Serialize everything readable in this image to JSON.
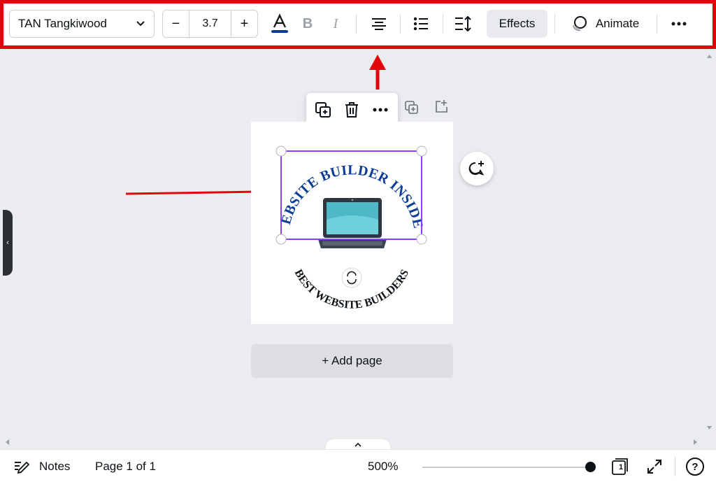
{
  "toolbar": {
    "font_name": "TAN Tangkiwood",
    "font_size": "3.7",
    "minus_label": "−",
    "plus_label": "+",
    "effects_label": "Effects",
    "animate_label": "Animate",
    "text_color": "#0b3c96",
    "highlight_color": "#e0060c"
  },
  "canvas": {
    "logo_top_text": "WEBSITE BUILDER INSIDER",
    "logo_bottom_text": "BEST WEBSITE BUILDERS",
    "add_page_label": "+ Add page",
    "selection_color": "#8b3dff",
    "arrow_color": "#e0060c"
  },
  "bottombar": {
    "notes_label": "Notes",
    "page_indicator": "Page 1 of 1",
    "zoom_level": "500%",
    "page_count": "1",
    "help_label": "?"
  }
}
